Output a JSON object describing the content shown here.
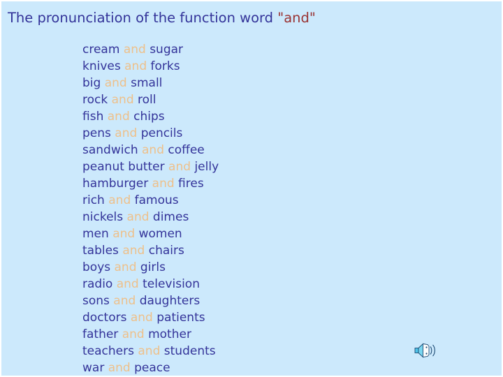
{
  "slide": {
    "background_color": "#cce9fc",
    "title": {
      "prefix": "The pronunciation of the function word ",
      "accent": "\"and\"",
      "text_color": "#333399",
      "accent_color": "#993333"
    },
    "word_list": {
      "conjunction": "and",
      "word_color": "#333399",
      "conjunction_color": "#eec08a",
      "pairs": [
        {
          "left": "cream",
          "and": "and",
          "right": "sugar"
        },
        {
          "left": "knives",
          "and": "and",
          "right": "forks"
        },
        {
          "left": "big",
          "and": "and",
          "right": "small"
        },
        {
          "left": "rock",
          "and": "and",
          "right": "roll"
        },
        {
          "left": "fish",
          "and": "and",
          "right": "chips"
        },
        {
          "left": "pens",
          "and": "and",
          "right": "pencils"
        },
        {
          "left": "sandwich",
          "and": "and",
          "right": "coffee"
        },
        {
          "left": "peanut butter",
          "and": "and",
          "right": "jelly"
        },
        {
          "left": "hamburger",
          "and": "and",
          "right": "fires"
        },
        {
          "left": "rich",
          "and": "and",
          "right": "famous"
        },
        {
          "left": "nickels",
          "and": "and",
          "right": "dimes"
        },
        {
          "left": "men",
          "and": "and",
          "right": "women"
        },
        {
          "left": "tables",
          "and": "and",
          "right": "chairs"
        },
        {
          "left": "boys",
          "and": "and",
          "right": "girls"
        },
        {
          "left": "radio",
          "and": "and",
          "right": "television"
        },
        {
          "left": "sons",
          "and": "and",
          "right": "daughters"
        },
        {
          "left": "doctors",
          "and": "and",
          "right": "patients"
        },
        {
          "left": "father",
          "and": "and",
          "right": "mother"
        },
        {
          "left": "teachers",
          "and": "and",
          "right": "students"
        },
        {
          "left": "war",
          "and": "and",
          "right": "peace"
        }
      ]
    },
    "media": {
      "sound_icon_name": "speaker-sound-icon",
      "sound_icon_color": "#4fc3e8"
    }
  }
}
